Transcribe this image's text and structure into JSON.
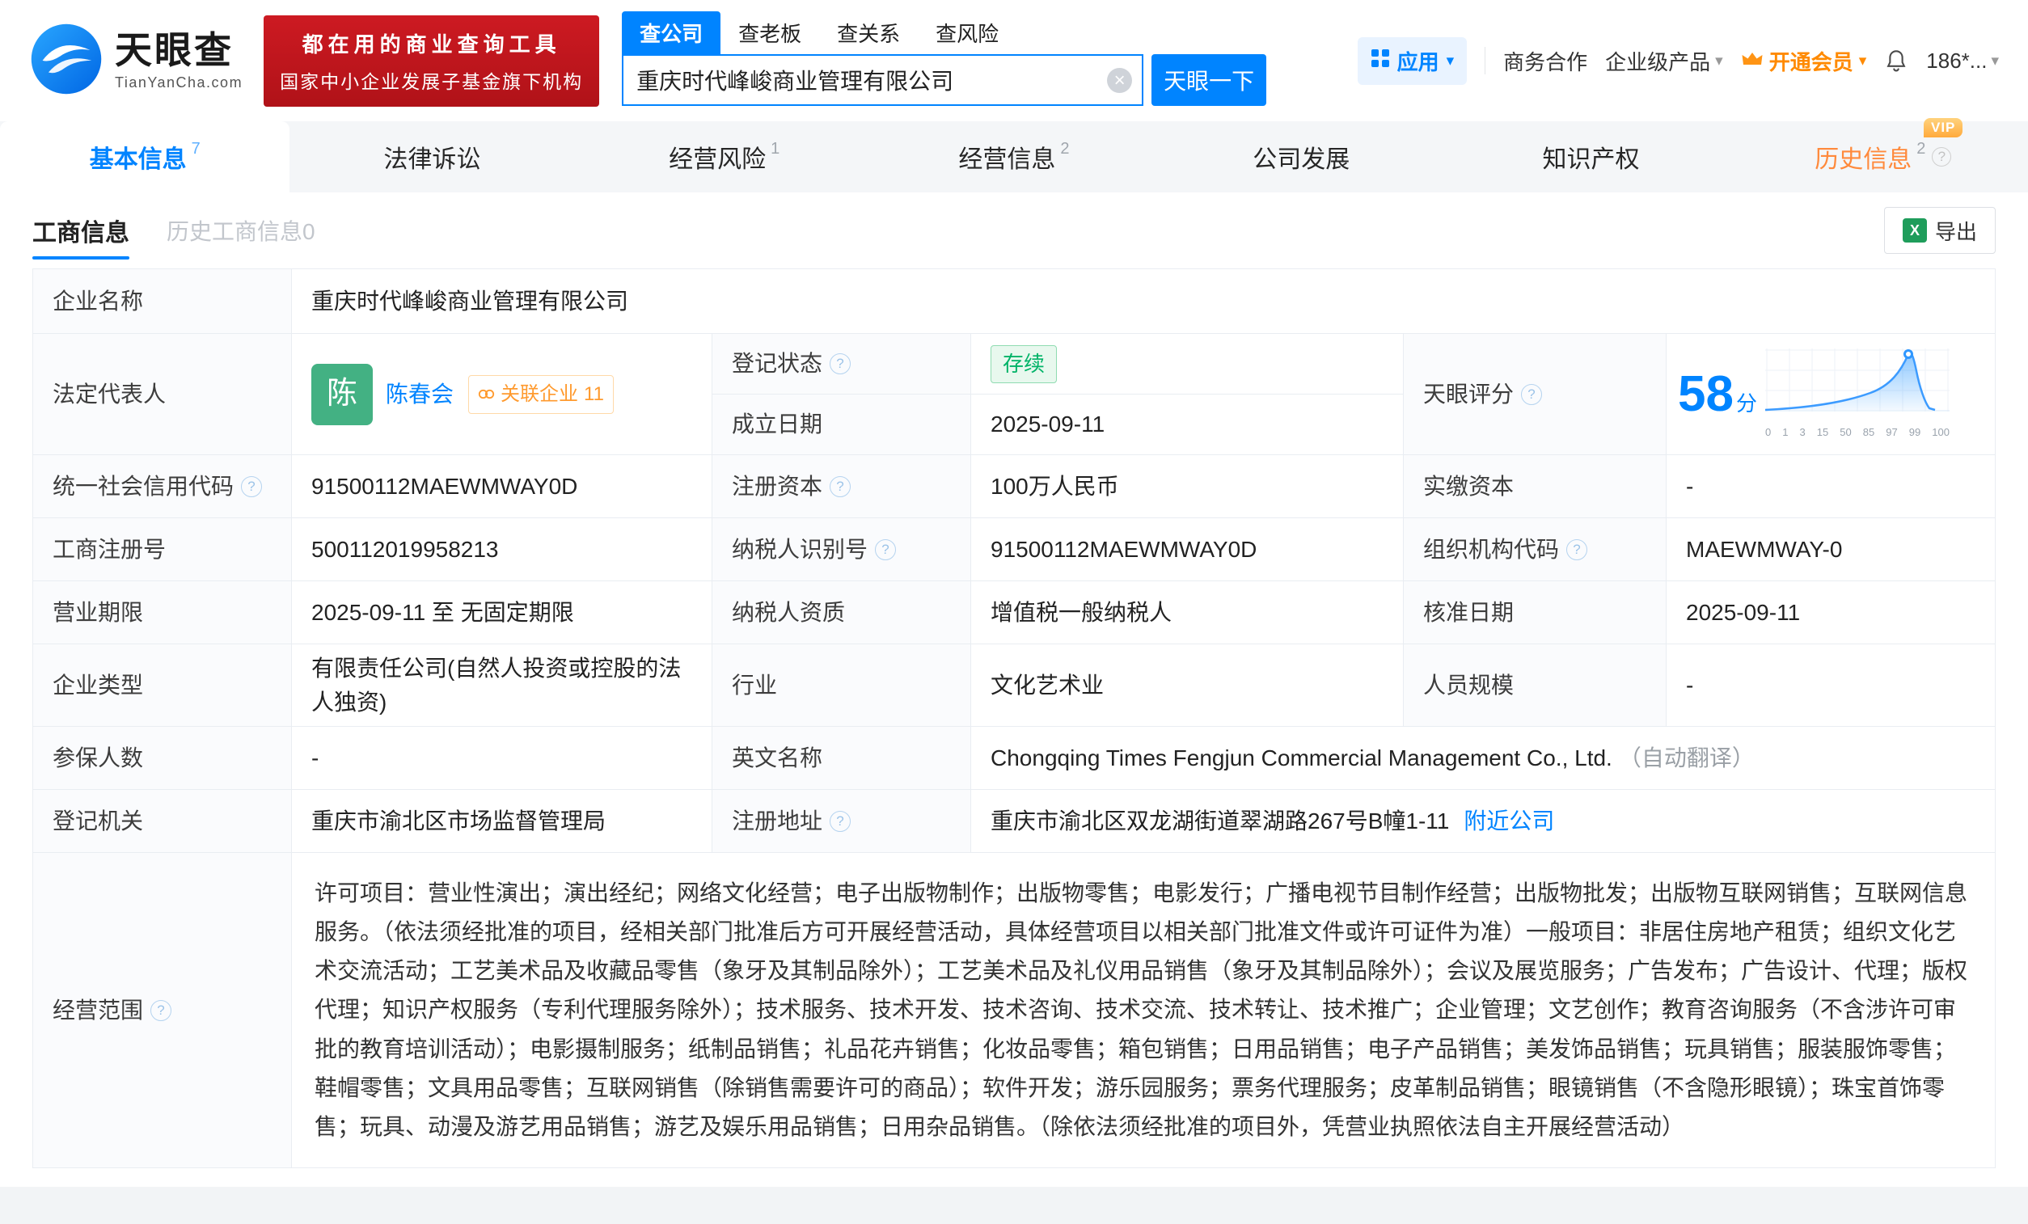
{
  "colors": {
    "brand": "#0084ff",
    "vip_orange": "#ff9a2e",
    "status_green": "#00b368",
    "banner_red": "#c2161f"
  },
  "icons": {
    "question": "?",
    "clear": "×",
    "caret": "▾",
    "excel": "X"
  },
  "header": {
    "logo": {
      "title": "天眼查",
      "domain": "TianYanCha.com"
    },
    "banner": {
      "line1": "都在用的商业查询工具",
      "line2": "国家中小企业发展子基金旗下机构"
    },
    "search": {
      "tabs": [
        {
          "label": "查公司"
        },
        {
          "label": "查老板"
        },
        {
          "label": "查关系"
        },
        {
          "label": "查风险"
        }
      ],
      "value": "重庆时代峰峻商业管理有限公司",
      "button": "天眼一下"
    },
    "actions": {
      "apps": "应用",
      "biz": "商务合作",
      "enterprise": "企业级产品",
      "vip": "开通会员",
      "phone": "186*..."
    }
  },
  "nav": {
    "vip_tag": "VIP",
    "tabs": [
      {
        "label": "基本信息",
        "badge": "7"
      },
      {
        "label": "法律诉讼",
        "badge": ""
      },
      {
        "label": "经营风险",
        "badge": "1"
      },
      {
        "label": "经营信息",
        "badge": "2"
      },
      {
        "label": "公司发展",
        "badge": ""
      },
      {
        "label": "知识产权",
        "badge": ""
      },
      {
        "label": "历史信息",
        "badge": "2"
      }
    ]
  },
  "toolbar": {
    "tabs": [
      {
        "label": "工商信息"
      },
      {
        "label": "历史工商信息0"
      }
    ],
    "export_label": "导出"
  },
  "fields": {
    "company_name": {
      "label": "企业名称",
      "value": "重庆时代峰峻商业管理有限公司"
    },
    "legal_rep": {
      "label": "法定代表人",
      "avatar_text": "陈",
      "name": "陈春会",
      "related_label": "关联企业",
      "related_count": "11"
    },
    "reg_status": {
      "label": "登记状态",
      "value": "存续"
    },
    "establish_date": {
      "label": "成立日期",
      "value": "2025-09-11"
    },
    "score": {
      "label": "天眼评分",
      "value": "58",
      "unit": "分"
    },
    "credit_code": {
      "label": "统一社会信用代码",
      "value": "91500112MAEWMWAY0D"
    },
    "reg_capital": {
      "label": "注册资本",
      "value": "100万人民币"
    },
    "paid_capital": {
      "label": "实缴资本",
      "value": "-"
    },
    "reg_number": {
      "label": "工商注册号",
      "value": "500112019958213"
    },
    "taxpayer_id": {
      "label": "纳税人识别号",
      "value": "91500112MAEWMWAY0D"
    },
    "org_code": {
      "label": "组织机构代码",
      "value": "MAEWMWAY-0"
    },
    "business_term": {
      "label": "营业期限",
      "value": "2025-09-11 至 无固定期限"
    },
    "taxpayer_quality": {
      "label": "纳税人资质",
      "value": "增值税一般纳税人"
    },
    "approval_date": {
      "label": "核准日期",
      "value": "2025-09-11"
    },
    "company_type": {
      "label": "企业类型",
      "value": "有限责任公司(自然人投资或控股的法人独资)"
    },
    "industry": {
      "label": "行业",
      "value": "文化艺术业"
    },
    "staff_size": {
      "label": "人员规模",
      "value": "-"
    },
    "insured_count": {
      "label": "参保人数",
      "value": "-"
    },
    "english_name": {
      "label": "英文名称",
      "value": "Chongqing Times Fengjun Commercial Management Co., Ltd.",
      "note": "（自动翻译）"
    },
    "reg_authority": {
      "label": "登记机关",
      "value": "重庆市渝北区市场监督管理局"
    },
    "reg_address": {
      "label": "注册地址",
      "value": "重庆市渝北区双龙湖街道翠湖路267号B幢1-11",
      "link": "附近公司"
    },
    "business_scope": {
      "label": "经营范围",
      "value": "许可项目：营业性演出；演出经纪；网络文化经营；电子出版物制作；出版物零售；电影发行；广播电视节目制作经营；出版物批发；出版物互联网销售；互联网信息服务。（依法须经批准的项目，经相关部门批准后方可开展经营活动，具体经营项目以相关部门批准文件或许可证件为准）一般项目：非居住房地产租赁；组织文化艺术交流活动；工艺美术品及收藏品零售（象牙及其制品除外）；工艺美术品及礼仪用品销售（象牙及其制品除外）；会议及展览服务；广告发布；广告设计、代理；版权代理；知识产权服务（专利代理服务除外）；技术服务、技术开发、技术咨询、技术交流、技术转让、技术推广；企业管理；文艺创作；教育咨询服务（不含涉许可审批的教育培训活动）；电影摄制服务；纸制品销售；礼品花卉销售；化妆品零售；箱包销售；日用品销售；电子产品销售；美发饰品销售；玩具销售；服装服饰零售；鞋帽零售；文具用品零售；互联网销售（除销售需要许可的商品）；软件开发；游乐园服务；票务代理服务；皮革制品销售；眼镜销售（不含隐形眼镜）；珠宝首饰零售；玩具、动漫及游艺用品销售；游艺及娱乐用品销售；日用杂品销售。（除依法须经批准的项目外，凭营业执照依法自主开展经营活动）"
    }
  },
  "score_chart": {
    "type": "area",
    "score": 58,
    "ticks": [
      "0",
      "1",
      "3",
      "15",
      "50",
      "85",
      "97",
      "99",
      "100"
    ]
  }
}
